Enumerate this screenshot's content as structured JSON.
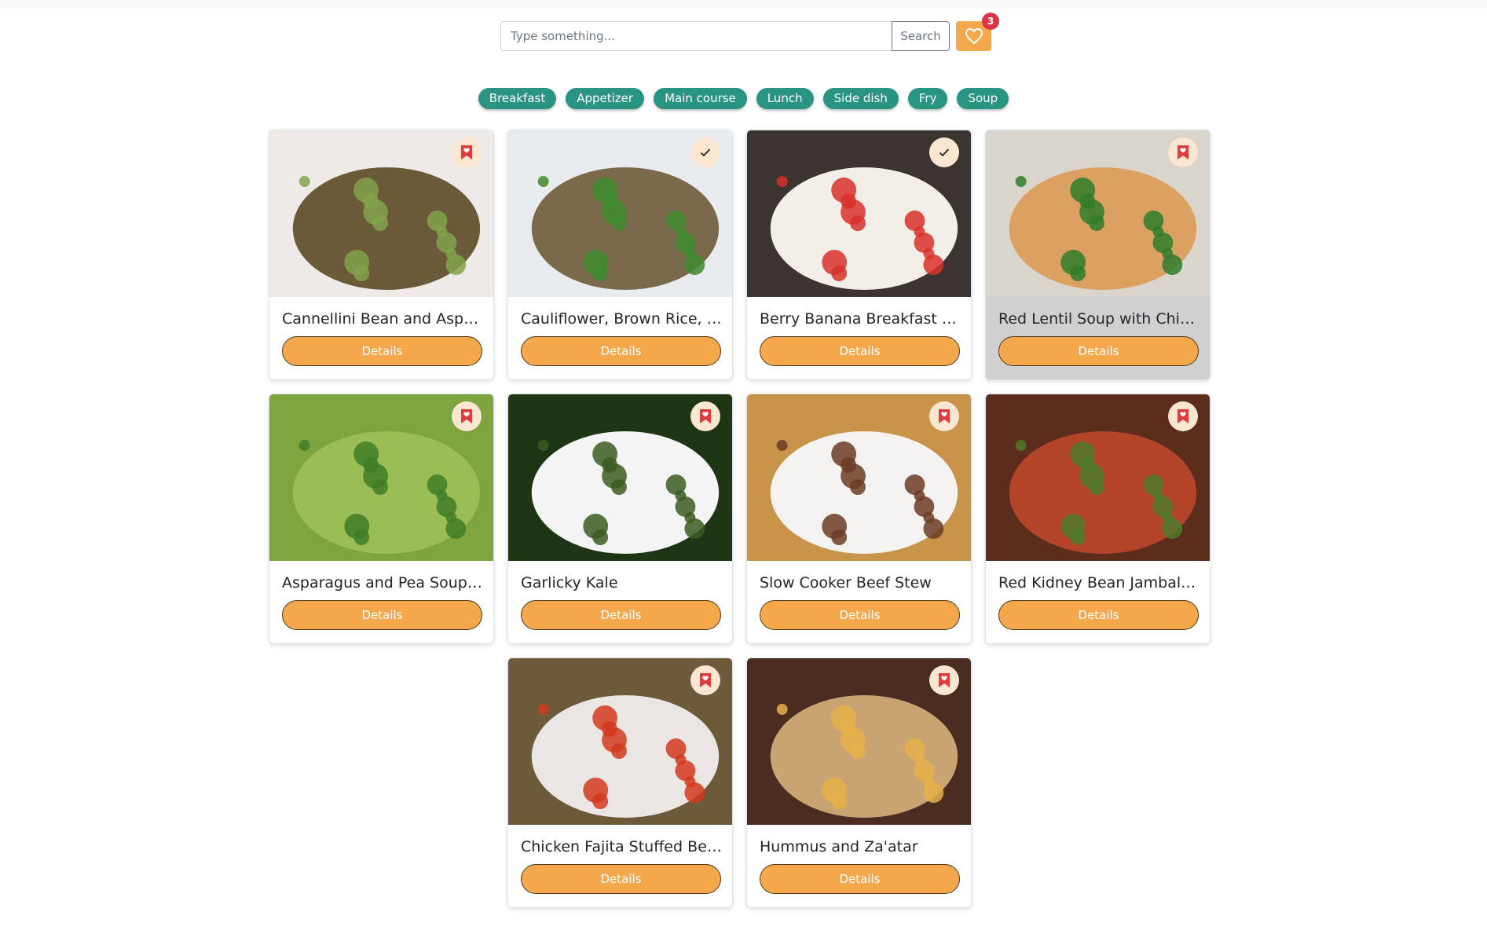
{
  "search": {
    "placeholder": "Type something...",
    "button_label": "Search"
  },
  "favorites": {
    "count": "3",
    "icon": "heart-outline-icon"
  },
  "categories": [
    "Breakfast",
    "Appetizer",
    "Main course",
    "Lunch",
    "Side dish",
    "Fry",
    "Soup"
  ],
  "recipes": [
    {
      "title": "Cannellini Bean and Asparagus",
      "details_label": "Details",
      "status": "bookmark",
      "highlighted": false,
      "colors": [
        "#eeeae8",
        "#6b5a3a",
        "#83a24b"
      ]
    },
    {
      "title": "Cauliflower, Brown Rice, and Vegetable Fried Rice",
      "details_label": "Details",
      "status": "check",
      "highlighted": false,
      "colors": [
        "#e8ecef",
        "#7a6a4b",
        "#3f8a2e"
      ]
    },
    {
      "title": "Berry Banana Breakfast Smoothie",
      "details_label": "Details",
      "status": "check",
      "highlighted": false,
      "colors": [
        "#3b3430",
        "#f2efe8",
        "#d8312a"
      ]
    },
    {
      "title": "Red Lentil Soup with Chicken and Turnips",
      "details_label": "Details",
      "status": "bookmark",
      "highlighted": true,
      "colors": [
        "#d9d4cc",
        "#dca060",
        "#2f7d2b"
      ]
    },
    {
      "title": "Asparagus and Pea Soup: Real Convenience Food",
      "details_label": "Details",
      "status": "bookmark",
      "highlighted": false,
      "colors": [
        "#7ea43f",
        "#9bbd55",
        "#3f7d26"
      ]
    },
    {
      "title": "Garlicky Kale",
      "details_label": "Details",
      "status": "bookmark",
      "highlighted": false,
      "colors": [
        "#1e3513",
        "#f4f4f4",
        "#3b5c22"
      ]
    },
    {
      "title": "Slow Cooker Beef Stew",
      "details_label": "Details",
      "status": "bookmark",
      "highlighted": false,
      "colors": [
        "#c8944a",
        "#f4f3f1",
        "#6b3b25"
      ]
    },
    {
      "title": "Red Kidney Bean Jambalaya",
      "details_label": "Details",
      "status": "bookmark",
      "highlighted": false,
      "colors": [
        "#5c2c1c",
        "#b3442a",
        "#4f7a2a"
      ]
    },
    {
      "title": "Chicken Fajita Stuffed Bell Pepper",
      "details_label": "Details",
      "status": "bookmark",
      "highlighted": false,
      "colors": [
        "#6d5a3a",
        "#e9e6e3",
        "#d2381f"
      ]
    },
    {
      "title": "Hummus and Za'atar",
      "details_label": "Details",
      "status": "bookmark",
      "highlighted": false,
      "colors": [
        "#4a2c20",
        "#c8a472",
        "#e6b24a"
      ]
    }
  ]
}
